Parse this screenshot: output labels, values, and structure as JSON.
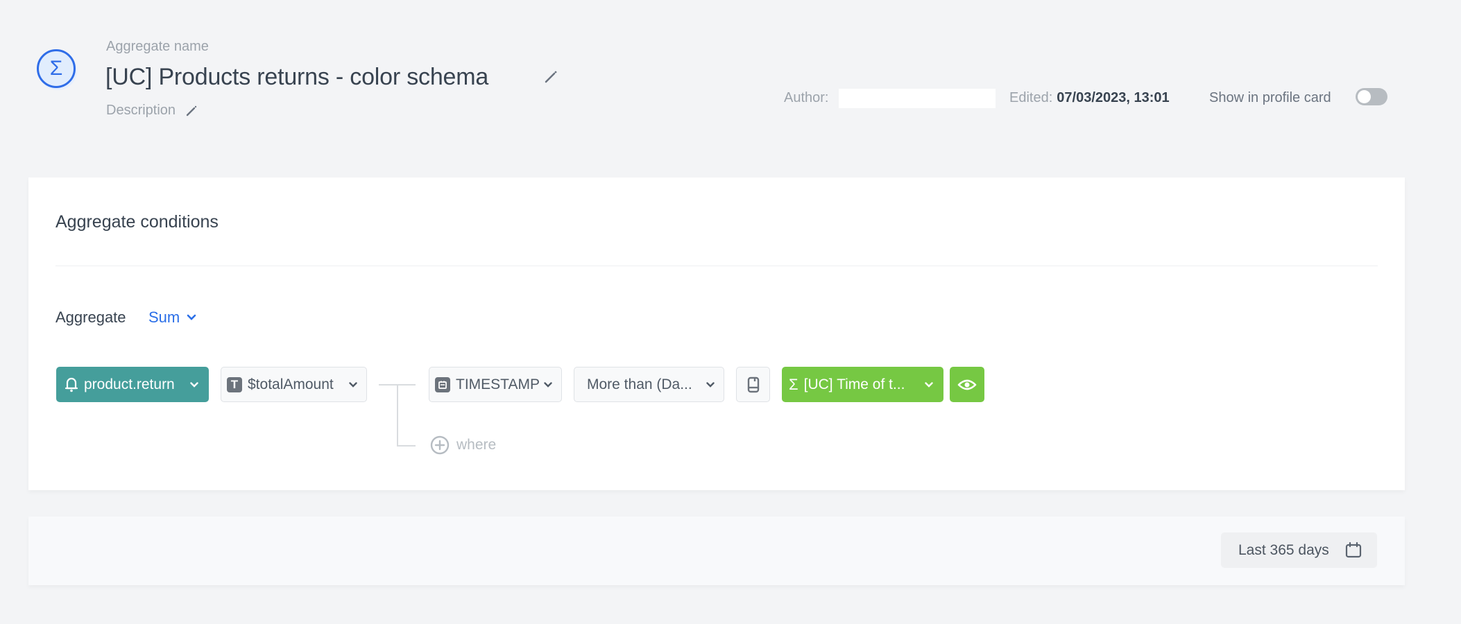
{
  "header": {
    "icon": "sigma-icon",
    "name_label": "Aggregate name",
    "title": "[UC] Products returns - color schema",
    "description_label": "Description",
    "author_label": "Author:",
    "author_value": "",
    "edited_label": "Edited:",
    "edited_value": "07/03/2023, 13:01",
    "show_in_profile_label": "Show in profile card",
    "show_in_profile_on": false
  },
  "conditions": {
    "title": "Aggregate conditions",
    "aggregate_label": "Aggregate",
    "aggregate_function": "Sum",
    "event": {
      "label": "product.return",
      "icon": "bell-icon",
      "color": "#459e9b"
    },
    "parameter": {
      "label": "$totalAmount",
      "icon": "text-type-icon",
      "icon_glyph": "T"
    },
    "filter_param": {
      "label": "TIMESTAMP",
      "icon": "calendar-type-icon"
    },
    "operator": {
      "label": "More than (Da..."
    },
    "value_source_icon": "book-icon",
    "value": {
      "label": "[UC] Time of t...",
      "icon": "sigma-icon",
      "color": "#76c843"
    },
    "preview_icon": "eye-icon",
    "where_label": "where"
  },
  "footer": {
    "date_range": "Last 365 days",
    "date_icon": "calendar-icon"
  },
  "colors": {
    "accent_blue": "#2b6fe8",
    "teal": "#459e9b",
    "green": "#76c843"
  }
}
